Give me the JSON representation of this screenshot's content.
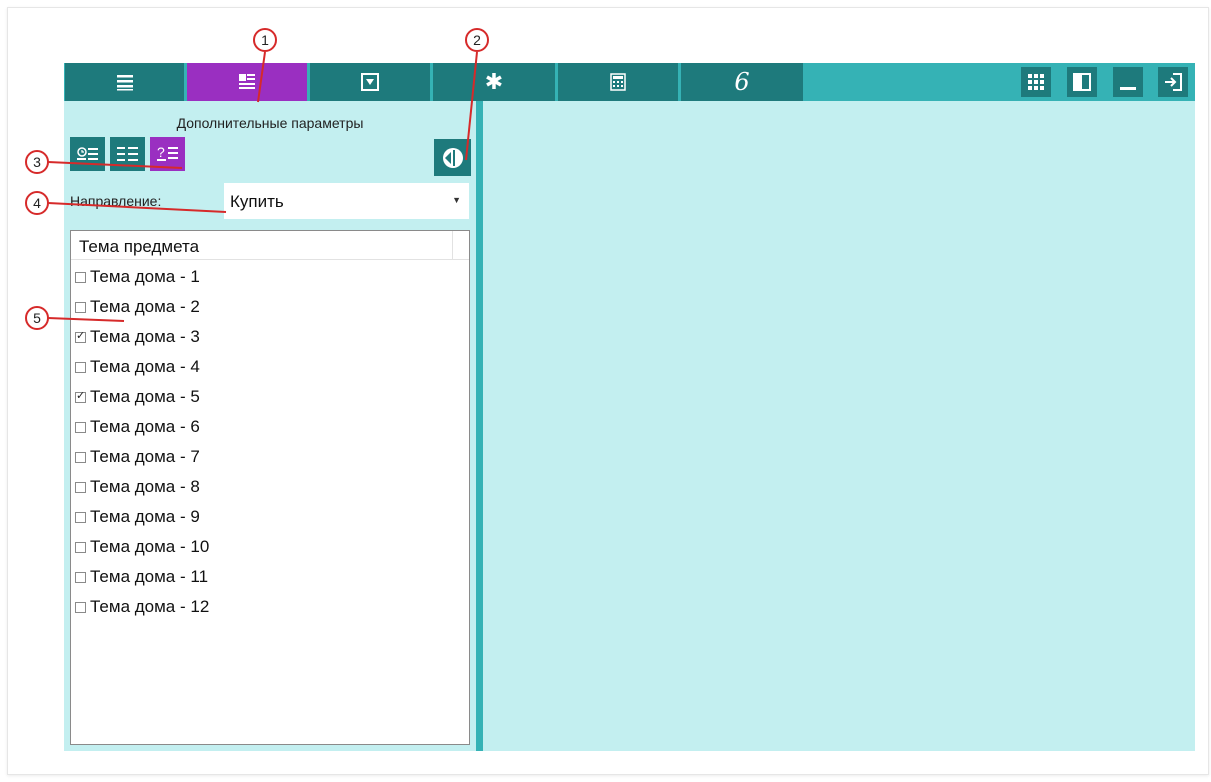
{
  "panel": {
    "title": "Дополнительные параметры",
    "direction_label": "Направление:",
    "direction_value": "Купить",
    "list_header": "Тема предмета",
    "items": [
      {
        "label": "Тема дома - 1",
        "checked": false
      },
      {
        "label": "Тема дома - 2",
        "checked": false
      },
      {
        "label": "Тема дома - 3",
        "checked": true
      },
      {
        "label": "Тема дома - 4",
        "checked": false
      },
      {
        "label": "Тема дома - 5",
        "checked": true
      },
      {
        "label": "Тема дома - 6",
        "checked": false
      },
      {
        "label": "Тема дома - 7",
        "checked": false
      },
      {
        "label": "Тема дома - 8",
        "checked": false
      },
      {
        "label": "Тема дома - 9",
        "checked": false
      },
      {
        "label": "Тема дома - 10",
        "checked": false
      },
      {
        "label": "Тема дома - 11",
        "checked": false
      },
      {
        "label": "Тема дома - 12",
        "checked": false
      }
    ]
  },
  "toolbar": {
    "tabs": [
      "list-icon",
      "fields-icon",
      "dropdown-icon",
      "gear-icon",
      "calculator-icon",
      "signature-icon"
    ],
    "active_tab": "fields-icon",
    "right_buttons": [
      "grid-icon",
      "panel-icon",
      "minimize-icon",
      "exit-icon"
    ]
  },
  "callouts": [
    "1",
    "2",
    "3",
    "4",
    "5"
  ],
  "colors": {
    "toolbar_bg": "#35b2b5",
    "button_teal": "#1e7a7c",
    "active_purple": "#9a2fc1",
    "panel_bg": "#c3eff0",
    "callout_red": "#d62a2a"
  }
}
